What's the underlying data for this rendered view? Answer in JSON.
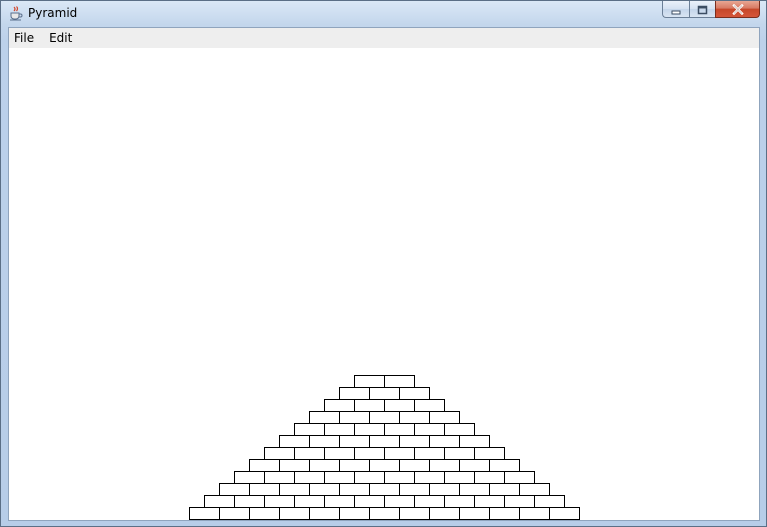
{
  "window": {
    "title": "Pyramid",
    "icon": "java-cup-icon",
    "controls": {
      "minimize": "minimize-icon",
      "maximize": "maximize-icon",
      "close": "close-icon"
    }
  },
  "menubar": {
    "items": [
      {
        "label": "File"
      },
      {
        "label": "Edit"
      }
    ]
  },
  "pyramid": {
    "rows": 12,
    "bricks_in_bottom_row": 13,
    "bricks_in_top_row": 2,
    "brick_color": "#ffffff",
    "outline_color": "#000000"
  }
}
